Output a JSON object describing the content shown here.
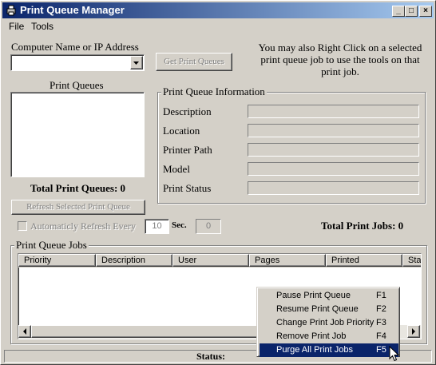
{
  "window": {
    "title": "Print Queue Manager",
    "min_glyph": "_",
    "max_glyph": "□",
    "close_glyph": "×"
  },
  "menu": {
    "file": "File",
    "tools": "Tools"
  },
  "computer": {
    "label": "Computer Name or IP Address",
    "value": "",
    "get_button": "Get Print Queues"
  },
  "hint": "You may also Right Click on a selected print queue job to use the tools on that print job.",
  "queues": {
    "label": "Print Queues",
    "total_label": "Total Print Queues: 0",
    "refresh_button": "Refresh Selected Print Queue"
  },
  "info": {
    "legend": "Print Queue Information",
    "fields": [
      {
        "label": "Description",
        "value": ""
      },
      {
        "label": "Location",
        "value": ""
      },
      {
        "label": "Printer Path",
        "value": ""
      },
      {
        "label": "Model",
        "value": ""
      },
      {
        "label": "Print Status",
        "value": ""
      }
    ]
  },
  "auto_refresh": {
    "label": "Automaticly Refresh Every",
    "interval": "10",
    "unit": "Sec.",
    "countdown": "0"
  },
  "total_jobs": "Total Print Jobs: 0",
  "jobs": {
    "legend": "Print Queue Jobs",
    "columns": [
      "Priority",
      "Description",
      "User",
      "Pages",
      "Printed",
      "Sta"
    ]
  },
  "context_menu": [
    {
      "label": "Pause Print Queue",
      "key": "F1"
    },
    {
      "label": "Resume Print Queue",
      "key": "F2"
    },
    {
      "label": "Change Print Job Priority",
      "key": "F3"
    },
    {
      "label": "Remove Print Job",
      "key": "F4"
    },
    {
      "label": "Purge All Print Jobs",
      "key": "F5"
    }
  ],
  "status": {
    "label": "Status:"
  },
  "colors": {
    "title_start": "#0a246a",
    "title_end": "#a6caf0",
    "face": "#d4d0c8",
    "selection": "#0a246a"
  }
}
